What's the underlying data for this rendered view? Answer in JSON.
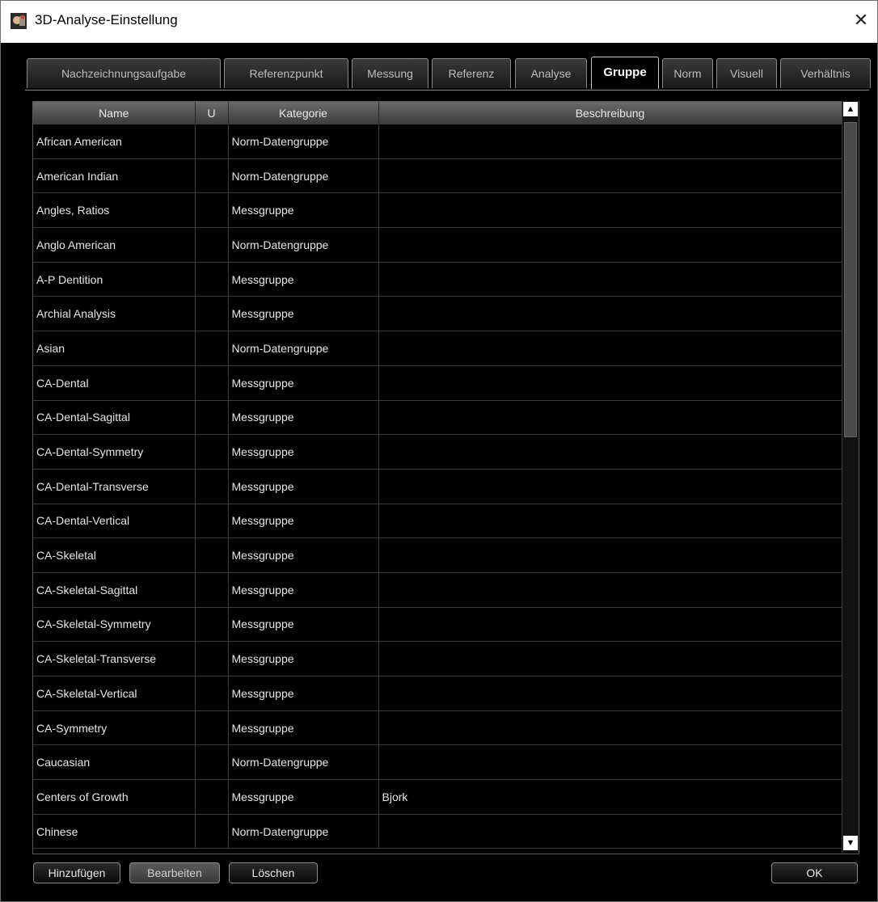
{
  "window": {
    "title": "3D-Analyse-Einstellung",
    "close_label": "✕"
  },
  "tabs": [
    {
      "label": "Nachzeichnungsaufgabe",
      "active": false
    },
    {
      "label": "Referenzpunkt",
      "active": false
    },
    {
      "label": "Messung",
      "active": false
    },
    {
      "label": "Referenz",
      "active": false
    },
    {
      "label": "Analyse",
      "active": false
    },
    {
      "label": "Gruppe",
      "active": true
    },
    {
      "label": "Norm",
      "active": false
    },
    {
      "label": "Visuell",
      "active": false
    },
    {
      "label": "Verhältnis",
      "active": false
    }
  ],
  "table": {
    "columns": [
      "Name",
      "U",
      "Kategorie",
      "Beschreibung"
    ],
    "rows": [
      [
        "African American",
        "",
        "Norm-Datengruppe",
        ""
      ],
      [
        "American Indian",
        "",
        "Norm-Datengruppe",
        ""
      ],
      [
        "Angles, Ratios",
        "",
        "Messgruppe",
        ""
      ],
      [
        "Anglo American",
        "",
        "Norm-Datengruppe",
        ""
      ],
      [
        "A-P Dentition",
        "",
        "Messgruppe",
        ""
      ],
      [
        "Archial Analysis",
        "",
        "Messgruppe",
        ""
      ],
      [
        "Asian",
        "",
        "Norm-Datengruppe",
        ""
      ],
      [
        "CA-Dental",
        "",
        "Messgruppe",
        ""
      ],
      [
        "CA-Dental-Sagittal",
        "",
        "Messgruppe",
        ""
      ],
      [
        "CA-Dental-Symmetry",
        "",
        "Messgruppe",
        ""
      ],
      [
        "CA-Dental-Transverse",
        "",
        "Messgruppe",
        ""
      ],
      [
        "CA-Dental-Vertical",
        "",
        "Messgruppe",
        ""
      ],
      [
        "CA-Skeletal",
        "",
        "Messgruppe",
        ""
      ],
      [
        "CA-Skeletal-Sagittal",
        "",
        "Messgruppe",
        ""
      ],
      [
        "CA-Skeletal-Symmetry",
        "",
        "Messgruppe",
        ""
      ],
      [
        "CA-Skeletal-Transverse",
        "",
        "Messgruppe",
        ""
      ],
      [
        "CA-Skeletal-Vertical",
        "",
        "Messgruppe",
        ""
      ],
      [
        "CA-Symmetry",
        "",
        "Messgruppe",
        ""
      ],
      [
        "Caucasian",
        "",
        "Norm-Datengruppe",
        ""
      ],
      [
        "Centers of Growth",
        "",
        "Messgruppe",
        "Bjork"
      ],
      [
        "Chinese",
        "",
        "Norm-Datengruppe",
        ""
      ]
    ]
  },
  "scrollbar": {
    "up_glyph": "▲",
    "down_glyph": "▼"
  },
  "buttons": {
    "add": "Hinzufügen",
    "edit": "Bearbeiten",
    "delete": "Löschen",
    "ok": "OK"
  }
}
